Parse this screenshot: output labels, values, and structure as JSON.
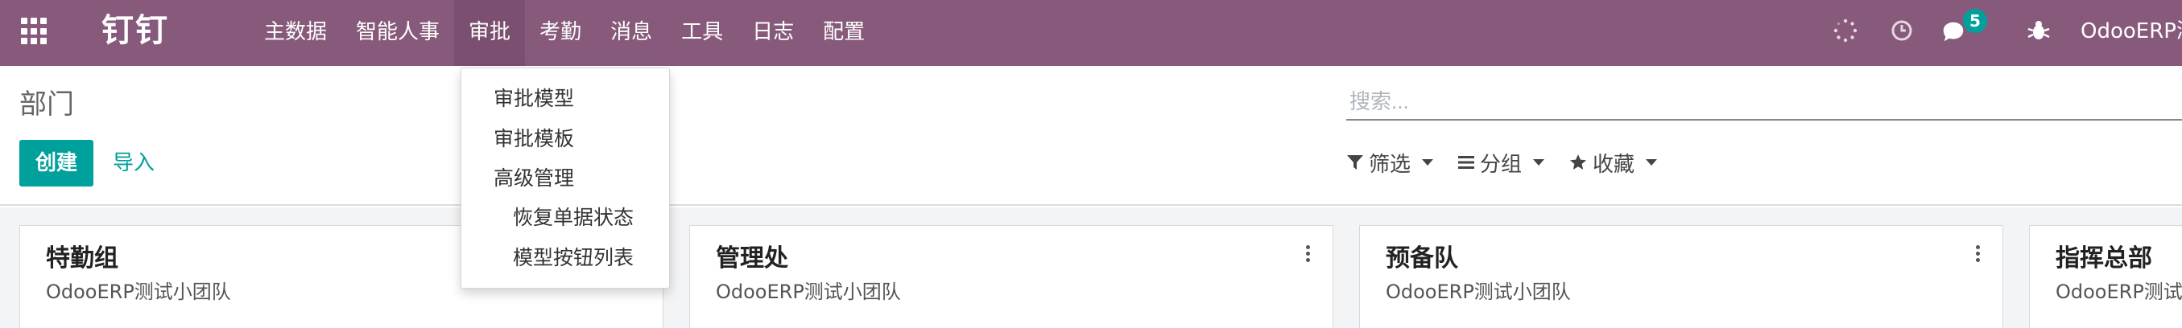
{
  "colors": {
    "navbar": "#875a7b",
    "navbar_active": "#7a4f6f",
    "primary": "#00a09d"
  },
  "navbar": {
    "brand": "钉钉",
    "menu": [
      "主数据",
      "智能人事",
      "审批",
      "考勤",
      "消息",
      "工具",
      "日志",
      "配置"
    ],
    "active_menu": "审批",
    "icons": [
      "apps-icon",
      "activity-spinner-icon",
      "clock-icon",
      "chat-icon",
      "bug-icon"
    ],
    "chat_badge": "5",
    "user_name": "OdooERP测"
  },
  "dropdown": {
    "items": [
      "审批模型",
      "审批模板",
      "高级管理"
    ],
    "sub_items": [
      "恢复单据状态",
      "模型按钮列表"
    ]
  },
  "control_panel": {
    "breadcrumb": "部门",
    "create_label": "创建",
    "import_label": "导入",
    "search_placeholder": "搜索...",
    "filters": [
      {
        "icon": "filter-icon",
        "label": "筛选"
      },
      {
        "icon": "group-by-icon",
        "label": "分组"
      },
      {
        "icon": "star-icon",
        "label": "收藏"
      }
    ]
  },
  "kanban": {
    "cards": [
      {
        "title": "特勤组",
        "subtitle": "OdooERP测试小团队"
      },
      {
        "title": "管理处",
        "subtitle": "OdooERP测试小团队"
      },
      {
        "title": "预备队",
        "subtitle": "OdooERP测试小团队"
      },
      {
        "title": "指挥总部",
        "subtitle": "OdooERP测试"
      }
    ]
  }
}
